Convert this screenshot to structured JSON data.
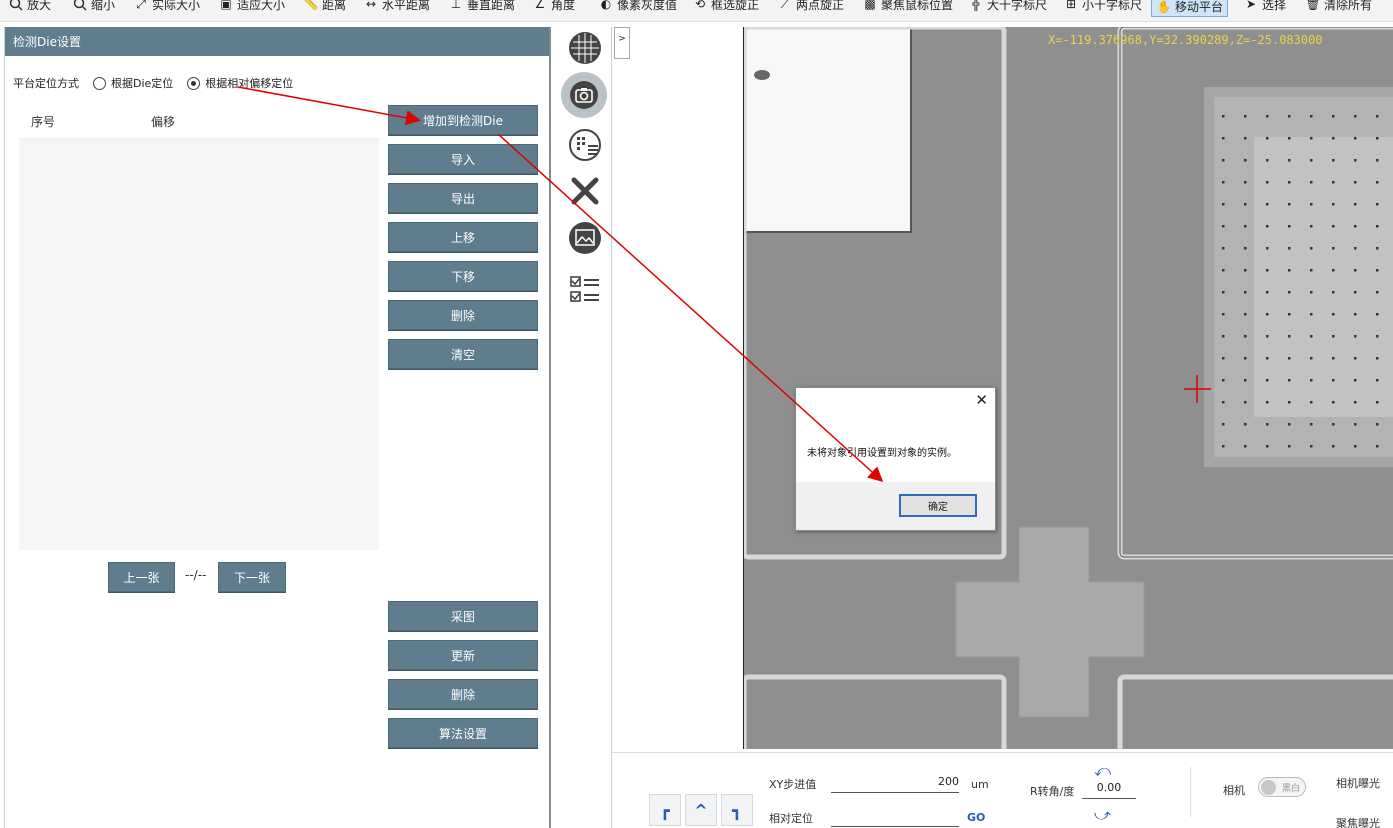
{
  "toolbar": {
    "items": [
      {
        "label": "放大",
        "icon": "zoom-in-icon"
      },
      {
        "label": "缩小",
        "icon": "zoom-out-icon"
      },
      {
        "label": "实际大小",
        "icon": "actual-size-icon"
      },
      {
        "label": "适应大小",
        "icon": "fit-size-icon"
      },
      {
        "label": "距离",
        "icon": "ruler-icon"
      },
      {
        "label": "水平距离",
        "icon": "horizontal-distance-icon"
      },
      {
        "label": "垂直距离",
        "icon": "vertical-distance-icon"
      },
      {
        "label": "角度",
        "icon": "angle-icon"
      },
      {
        "label": "像素灰度值",
        "icon": "gray-value-icon"
      },
      {
        "label": "框选旋正",
        "icon": "box-rotate-icon"
      },
      {
        "label": "两点旋正",
        "icon": "two-point-rotate-icon"
      },
      {
        "label": "聚焦鼠标位置",
        "icon": "focus-mouse-icon"
      },
      {
        "label": "大十字标尺",
        "icon": "big-cross-icon"
      },
      {
        "label": "小十字标尺",
        "icon": "small-cross-icon"
      },
      {
        "label": "移动平台",
        "icon": "hand-icon",
        "active": true
      },
      {
        "label": "选择",
        "icon": "cursor-icon"
      },
      {
        "label": "清除所有",
        "icon": "trash-icon"
      }
    ]
  },
  "left_panel": {
    "title": "检测Die设置",
    "positioning_label": "平台定位方式",
    "radio_die": "根据Die定位",
    "radio_offset": "根据相对偏移定位",
    "selected_radio": "offset",
    "table_headers": [
      "序号",
      "偏移"
    ],
    "buttons": {
      "add_die": "增加到检测Die",
      "import": "导入",
      "export": "导出",
      "move_up": "上移",
      "move_down": "下移",
      "delete": "删除",
      "clear": "清空",
      "capture": "采图",
      "update": "更新",
      "delete2": "删除",
      "algo_settings": "算法设置"
    },
    "pager": {
      "prev": "上一张",
      "indicator": "--/--",
      "next": "下一张"
    }
  },
  "sidebar_icons": [
    "wafer-map-icon",
    "camera-icon",
    "die-grid-icon",
    "tools-icon",
    "image-icon",
    "checklist-icon"
  ],
  "viewer": {
    "expand_label": ">",
    "coordinates": "X=-119.376968,Y=32.390289,Z=-25.083000"
  },
  "dialog": {
    "message": "未将对象引用设置到对象的实例。",
    "ok_label": "确定",
    "close_symbol": "✕"
  },
  "bottom": {
    "xy_step_label": "XY步进值",
    "xy_step_value": "200",
    "xy_step_unit": "um",
    "relative_pos_label": "相对定位",
    "relative_pos_value": "",
    "go_label": "GO",
    "r_angle_label": "R转角/度",
    "r_angle_value": "0.00",
    "camera_label": "相机",
    "camera_toggle_text": "黑白",
    "camera_exposure_label": "相机曝光",
    "focus_exposure_label": "聚焦曝光"
  },
  "colors": {
    "panel_header": "#5f7d8c",
    "button": "#5f7d8c",
    "annotation_arrow": "#e00000",
    "coord_text": "#e8d24a"
  }
}
